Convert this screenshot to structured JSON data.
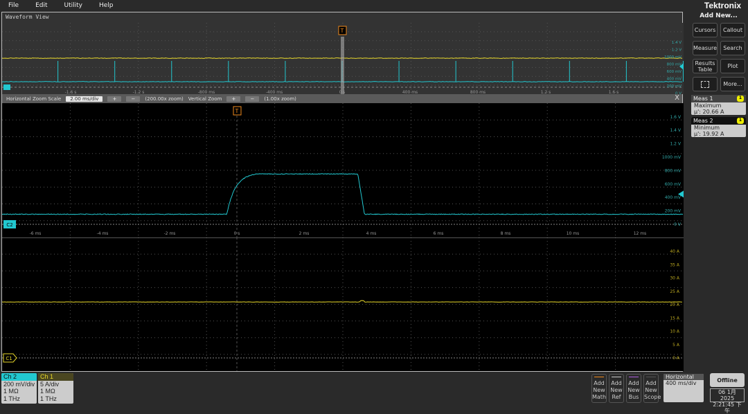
{
  "menu": [
    "File",
    "Edit",
    "Utility",
    "Help"
  ],
  "brand": "Tektronix",
  "waveform_view": {
    "title": "Waveform View",
    "overview_time_labels": [
      "-1.6 s",
      "-1.2 s",
      "-800 ms",
      "-400 ms",
      "0 s",
      "400 ms",
      "800 ms",
      "1.2 s",
      "1.6 s"
    ],
    "overview_volt_labels": [
      "1.4 V",
      "1.2 V",
      "1000 mV",
      "800 mV",
      "600 mV",
      "400 mV",
      "200 mV",
      "0 V"
    ],
    "zoom_bar": {
      "h_label": "Horizontal Zoom Scale",
      "h_value": "2.00 ms/div",
      "h_zoom": "(200.00x zoom)",
      "v_label": "Vertical Zoom",
      "v_zoom": "(1.00x zoom)",
      "plus": "+",
      "minus": "−",
      "close": "X"
    },
    "trigger_marker": "T",
    "ch2_marker": "C2",
    "ch1_marker": "C1",
    "ch2_time_labels": [
      "-6 ms",
      "-4 ms",
      "-2 ms",
      "0 s",
      "2 ms",
      "4 ms",
      "6 ms",
      "8 ms",
      "10 ms",
      "12 ms"
    ],
    "ch2_volt_labels": [
      "1.6 V",
      "1.4 V",
      "1.2 V",
      "1000 mV",
      "800 mV",
      "600 mV",
      "400 mV",
      "200 mV",
      "0 V"
    ],
    "ch1_amp_labels": [
      "40 A",
      "35 A",
      "30 A",
      "25 A",
      "20 A",
      "15 A",
      "10 A",
      "5 A",
      "0 A"
    ]
  },
  "colors": {
    "ch1": "#e8d82a",
    "ch2": "#22c8d0",
    "trigger": "#f08a1c"
  },
  "traces": {
    "ch2_pulse": {
      "baseline_V": 0.15,
      "high_V": 0.75,
      "rise_start_ms": -0.3,
      "rise_end_ms": 0.6,
      "fall_ms": 3.6
    },
    "ch1_level_A": 21,
    "overview_ch2_spike_period_s": 0.335
  },
  "right_panel": {
    "title": "Add New...",
    "buttons": [
      "Cursors",
      "Callout",
      "Measure",
      "Search",
      "Results Table",
      "Plot",
      "",
      "More..."
    ],
    "meas": [
      {
        "name": "Meas 1",
        "badge": "1",
        "type": "Maximum",
        "value": "μ': 20.66 A"
      },
      {
        "name": "Meas 2",
        "badge": "1",
        "type": "Minimum",
        "value": "μ': 19.92 A"
      }
    ]
  },
  "bottom": {
    "ch2": {
      "title": "Ch 2",
      "scale": "200 mV/div",
      "impedance": "1 MΩ",
      "bw": "1 THz"
    },
    "ch1": {
      "title": "Ch 1",
      "scale": "5 A/div",
      "impedance": "1 MΩ",
      "bw": "1 THz"
    },
    "add": [
      {
        "l1": "Add",
        "l2": "New",
        "l3": "Math",
        "color": "#f08a1c"
      },
      {
        "l1": "Add",
        "l2": "New",
        "l3": "Ref",
        "color": "#cccccc"
      },
      {
        "l1": "Add",
        "l2": "New",
        "l3": "Bus",
        "color": "#b060e0"
      },
      {
        "l1": "Add",
        "l2": "New",
        "l3": "Scope",
        "color": "#555555"
      }
    ],
    "horizontal": {
      "title": "Horizontal",
      "scale": "400 ms/div"
    },
    "status": "Offline",
    "date": "06 1月 2025",
    "time": "2:21:45 下午"
  }
}
